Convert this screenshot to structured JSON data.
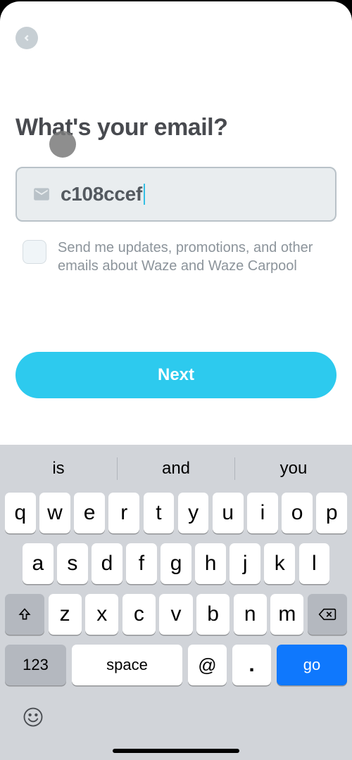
{
  "header": {
    "title": "What's your email?"
  },
  "email_input": {
    "value": "c108ccef"
  },
  "checkbox": {
    "label": "Send me updates, promotions, and other emails about Waze and Waze Carpool"
  },
  "buttons": {
    "next": "Next"
  },
  "keyboard": {
    "suggestions": [
      "is",
      "and",
      "you"
    ],
    "row1": [
      "q",
      "w",
      "e",
      "r",
      "t",
      "y",
      "u",
      "i",
      "o",
      "p"
    ],
    "row2": [
      "a",
      "s",
      "d",
      "f",
      "g",
      "h",
      "j",
      "k",
      "l"
    ],
    "row3": [
      "z",
      "x",
      "c",
      "v",
      "b",
      "n",
      "m"
    ],
    "numbers_key": "123",
    "space_key": "space",
    "at_key": "@",
    "dot_key": ".",
    "go_key": "go"
  }
}
